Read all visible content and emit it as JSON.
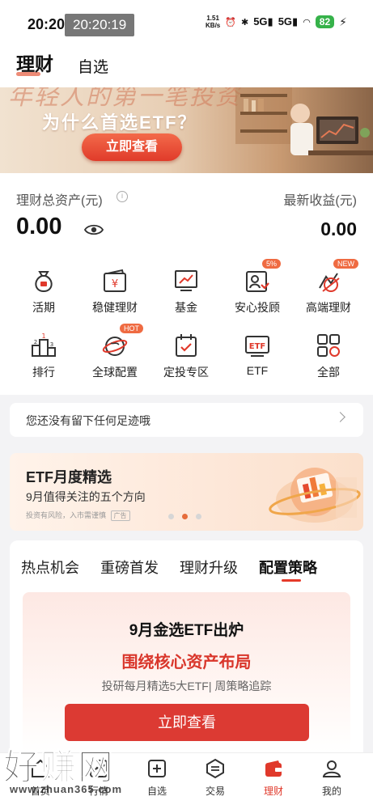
{
  "status_bar": {
    "time": "20:20",
    "time_overlay": "20:20:19",
    "net_speed_value": "1.51",
    "net_speed_unit": "KB/s",
    "signal_1": "5G",
    "signal_2": "5G",
    "battery": "82"
  },
  "header": {
    "tab_main": "理财",
    "tab_secondary": "自选"
  },
  "banner": {
    "scribble": "年轻人的第一笔投资",
    "title": "为什么首选ETF？",
    "button": "立即查看"
  },
  "assets": {
    "total_label": "理财总资产(元)",
    "total_value": "0.00",
    "earn_label": "最新收益(元)",
    "earn_value": "0.00"
  },
  "grid": {
    "items": [
      {
        "label": "活期",
        "icon": "money-bag-icon"
      },
      {
        "label": "稳健理财",
        "icon": "yuan-wallet-icon"
      },
      {
        "label": "基金",
        "icon": "chart-board-icon"
      },
      {
        "label": "安心投顾",
        "icon": "advisor-icon",
        "badge": "5%"
      },
      {
        "label": "高端理财",
        "icon": "premium-icon",
        "badge": "NEW"
      },
      {
        "label": "排行",
        "icon": "podium-icon"
      },
      {
        "label": "全球配置",
        "icon": "globe-icon",
        "badge": "HOT"
      },
      {
        "label": "定投专区",
        "icon": "calendar-check-icon"
      },
      {
        "label": "ETF",
        "icon": "etf-icon"
      },
      {
        "label": "全部",
        "icon": "all-grid-icon"
      }
    ]
  },
  "footprint": {
    "text": "您还没有留下任何足迹哦"
  },
  "etf_promo": {
    "title": "ETF月度精选",
    "subtitle": "9月值得关注的五个方向",
    "note": "投资有风险，入市需谨慎",
    "ad": "广告"
  },
  "strategy": {
    "tabs": [
      "热点机会",
      "重磅首发",
      "理财升级",
      "配置策略"
    ],
    "active_tab": "配置策略",
    "card_title": "9月金选ETF出炉",
    "card_subtitle": "围绕核心资产布局",
    "card_desc": "投研每月精选5大ETF| 周策略追踪",
    "card_button": "立即查看"
  },
  "bottom_nav": {
    "items": [
      {
        "label": "首页",
        "icon": "home-icon"
      },
      {
        "label": "行情",
        "icon": "market-icon"
      },
      {
        "label": "自选",
        "icon": "add-watchlist-icon"
      },
      {
        "label": "交易",
        "icon": "trade-icon"
      },
      {
        "label": "理财",
        "icon": "wealth-icon"
      },
      {
        "label": "我的",
        "icon": "profile-icon"
      }
    ],
    "active": "理财"
  },
  "watermark": {
    "big": "好赚网",
    "small": "www.zhuan365.com"
  },
  "colors": {
    "accent": "#e0392b",
    "badge": "#ef6b42",
    "battery": "#36b24a"
  }
}
